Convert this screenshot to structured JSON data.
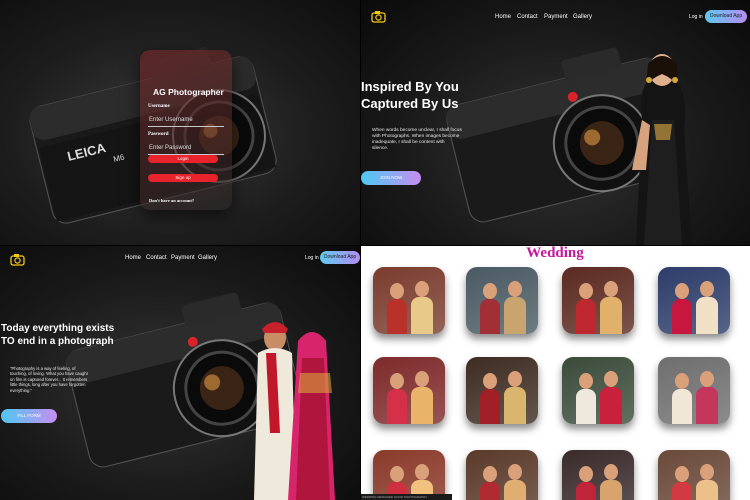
{
  "brand": {
    "logo": "camera-icon",
    "accent": "#f2c811"
  },
  "login": {
    "title": "AG Photographer",
    "username_label": "Username",
    "username_placeholder": "Enter Username",
    "password_label": "Password",
    "password_placeholder": "Enter Password",
    "login_button": "Login",
    "signup_button": "Sign up",
    "no_account": "Don't have an account?"
  },
  "nav": {
    "items": [
      "Home",
      "Contact",
      "Payment",
      "Gallery"
    ],
    "login": "Log in",
    "download": "Download App"
  },
  "hero1": {
    "heading_line1": "Inspired By You",
    "heading_line2": "Captured By Us",
    "paragraph": "When words become unclear, I shall focus with Photographs. When images become inadequate, I shall be content with silence.",
    "button": "JOIN NOW"
  },
  "hero2": {
    "heading_line1": "Today everything exists",
    "heading_line2": "TO end in a photograph",
    "paragraph": "\"Photography is a way of feeling, of touching, of loving. What you have caught on film is captured forever... It remembers little things, long after you have forgotten everything.\"",
    "button": "FILL FORM"
  },
  "camera_text": {
    "brand": "LEICA",
    "model": "M6"
  },
  "gallery": {
    "title": "Wedding",
    "footer": "WEDDING DESIGNED GOOD PHOTOGRAPHY"
  },
  "colors": {
    "pill_red": "#e8232b",
    "gradient_start": "#4ec9f3",
    "gradient_end": "#c78df0",
    "gallery_title": "#c2189a"
  }
}
